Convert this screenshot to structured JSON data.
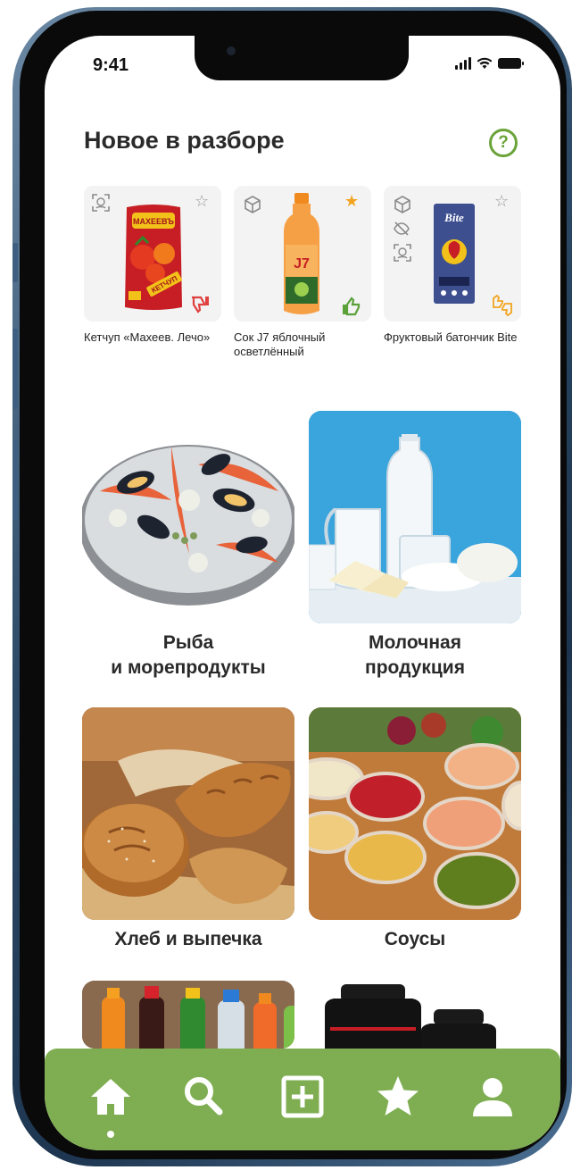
{
  "status_bar": {
    "time": "9:41"
  },
  "section": {
    "title": "Новое в разборе",
    "help_label": "?"
  },
  "products": [
    {
      "name": "Кетчуп «Махеев. Лечо»",
      "favorite": false,
      "rating": "dislike",
      "package_brand": "МАХЕЕВЪ",
      "package_label": "КЕТЧУП"
    },
    {
      "name": "Сок J7 яблочный осветлённый",
      "favorite": true,
      "rating": "like",
      "package_brand": "J7"
    },
    {
      "name": "Фруктовый батончик Bite",
      "favorite": false,
      "rating": "neutral",
      "package_brand": "Bite"
    }
  ],
  "categories": [
    {
      "label_line1": "Рыба",
      "label_line2": "и морепродукты"
    },
    {
      "label_line1": "Молочная",
      "label_line2": "продукция"
    },
    {
      "label_line1": "Хлеб и выпечка",
      "label_line2": ""
    },
    {
      "label_line1": "Соусы",
      "label_line2": ""
    }
  ],
  "bottom_nav": {
    "items": [
      "home",
      "search",
      "add",
      "favorites",
      "profile"
    ],
    "active": "home",
    "accent_color": "#7fae52"
  },
  "colors": {
    "accent": "#6aa338",
    "favorite": "#f2a420",
    "dislike": "#e04040",
    "like": "#5aa13a"
  }
}
